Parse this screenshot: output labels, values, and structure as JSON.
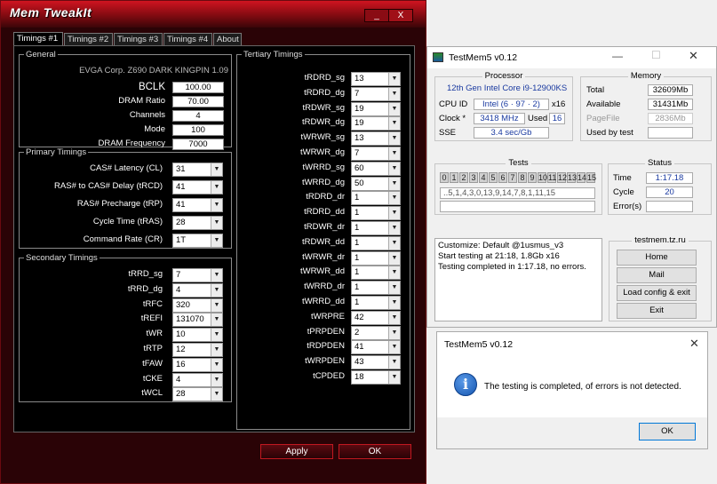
{
  "memtweak": {
    "title": "Mem TweakIt",
    "tabs": [
      "Timings #1",
      "Timings #2",
      "Timings #3",
      "Timings #4",
      "About"
    ],
    "general": {
      "legend": "General",
      "board": "EVGA Corp. Z690 DARK KINGPIN 1.09",
      "rows": [
        {
          "label": "BCLK",
          "value": "100.00"
        },
        {
          "label": "DRAM Ratio",
          "value": "70.00"
        },
        {
          "label": "Channels",
          "value": "4"
        },
        {
          "label": "Mode",
          "value": "100"
        },
        {
          "label": "DRAM Frequency",
          "value": "7000"
        }
      ]
    },
    "primary": {
      "legend": "Primary Timings",
      "rows": [
        {
          "label": "CAS# Latency (CL)",
          "value": "31"
        },
        {
          "label": "RAS# to CAS# Delay (tRCD)",
          "value": "41"
        },
        {
          "label": "RAS# Precharge (tRP)",
          "value": "41"
        },
        {
          "label": "Cycle Time (tRAS)",
          "value": "28"
        },
        {
          "label": "Command Rate (CR)",
          "value": "1T"
        }
      ]
    },
    "secondary": {
      "legend": "Secondary Timings",
      "rows": [
        {
          "label": "tRRD_sg",
          "value": "7"
        },
        {
          "label": "tRRD_dg",
          "value": "4"
        },
        {
          "label": "tRFC",
          "value": "320"
        },
        {
          "label": "tREFI",
          "value": "131070"
        },
        {
          "label": "tWR",
          "value": "10"
        },
        {
          "label": "tRTP",
          "value": "12"
        },
        {
          "label": "tFAW",
          "value": "16"
        },
        {
          "label": "tCKE",
          "value": "4"
        },
        {
          "label": "tWCL",
          "value": "28"
        }
      ]
    },
    "tertiary": {
      "legend": "Tertiary Timings",
      "rows": [
        {
          "label": "tRDRD_sg",
          "value": "13"
        },
        {
          "label": "tRDRD_dg",
          "value": "7"
        },
        {
          "label": "tRDWR_sg",
          "value": "19"
        },
        {
          "label": "tRDWR_dg",
          "value": "19"
        },
        {
          "label": "tWRWR_sg",
          "value": "13"
        },
        {
          "label": "tWRWR_dg",
          "value": "7"
        },
        {
          "label": "tWRRD_sg",
          "value": "60"
        },
        {
          "label": "tWRRD_dg",
          "value": "50"
        },
        {
          "label": "tRDRD_dr",
          "value": "1"
        },
        {
          "label": "tRDRD_dd",
          "value": "1"
        },
        {
          "label": "tRDWR_dr",
          "value": "1"
        },
        {
          "label": "tRDWR_dd",
          "value": "1"
        },
        {
          "label": "tWRWR_dr",
          "value": "1"
        },
        {
          "label": "tWRWR_dd",
          "value": "1"
        },
        {
          "label": "tWRRD_dr",
          "value": "1"
        },
        {
          "label": "tWRRD_dd",
          "value": "1"
        },
        {
          "label": "tWRPRE",
          "value": "42"
        },
        {
          "label": "tPRPDEN",
          "value": "2"
        },
        {
          "label": "tRDPDEN",
          "value": "41"
        },
        {
          "label": "tWRPDEN",
          "value": "43"
        },
        {
          "label": "tCPDED",
          "value": "18"
        }
      ]
    },
    "apply": "Apply",
    "ok": "OK",
    "minimize": "_",
    "close": "X"
  },
  "testmem": {
    "title": "TestMem5 v0.12",
    "processor": {
      "caption": "Processor",
      "name": "12th Gen Intel Core i9-12900KS",
      "cpuid_label": "CPU ID",
      "cpuid": "Intel (6 · 97 · 2)",
      "threads": "x16",
      "clock_label": "Clock *",
      "clock": "3418 MHz",
      "used_label": "Used",
      "used": "16",
      "sse_label": "SSE",
      "sse": "3.4 sec/Gb"
    },
    "memory": {
      "caption": "Memory",
      "total_label": "Total",
      "total": "32609Mb",
      "avail_label": "Available",
      "avail": "31431Mb",
      "page_label": "PageFile",
      "page": "2836Mb",
      "usedby_label": "Used by test",
      "usedby": ""
    },
    "tests": {
      "caption": "Tests",
      "cells": [
        "0",
        "1",
        "2",
        "3",
        "4",
        "5",
        "6",
        "7",
        "8",
        "9",
        "10",
        "11",
        "12",
        "13",
        "14",
        "15"
      ],
      "sequence": "..5,1,4,3,0,13,9,14,7,8,1,11,15"
    },
    "status": {
      "caption": "Status",
      "time_label": "Time",
      "time": "1:17.18",
      "cycle_label": "Cycle",
      "cycle": "20",
      "errors_label": "Error(s)",
      "errors": ""
    },
    "log": [
      "Customize: Default @1usmus_v3",
      "Start testing at 21:18, 1.8Gb x16",
      "Testing completed in 1:17.18, no errors."
    ],
    "site": "testmem.tz.ru",
    "buttons": [
      "Home",
      "Mail",
      "Load config & exit",
      "Exit"
    ]
  },
  "msgbox": {
    "title": "TestMem5 v0.12",
    "message": "The testing is completed, of errors is not detected.",
    "ok": "OK",
    "icon": "i"
  },
  "colors": {
    "accent_red": "#c01820",
    "link_blue": "#1a3aa0",
    "info_blue": "#1565c0"
  }
}
